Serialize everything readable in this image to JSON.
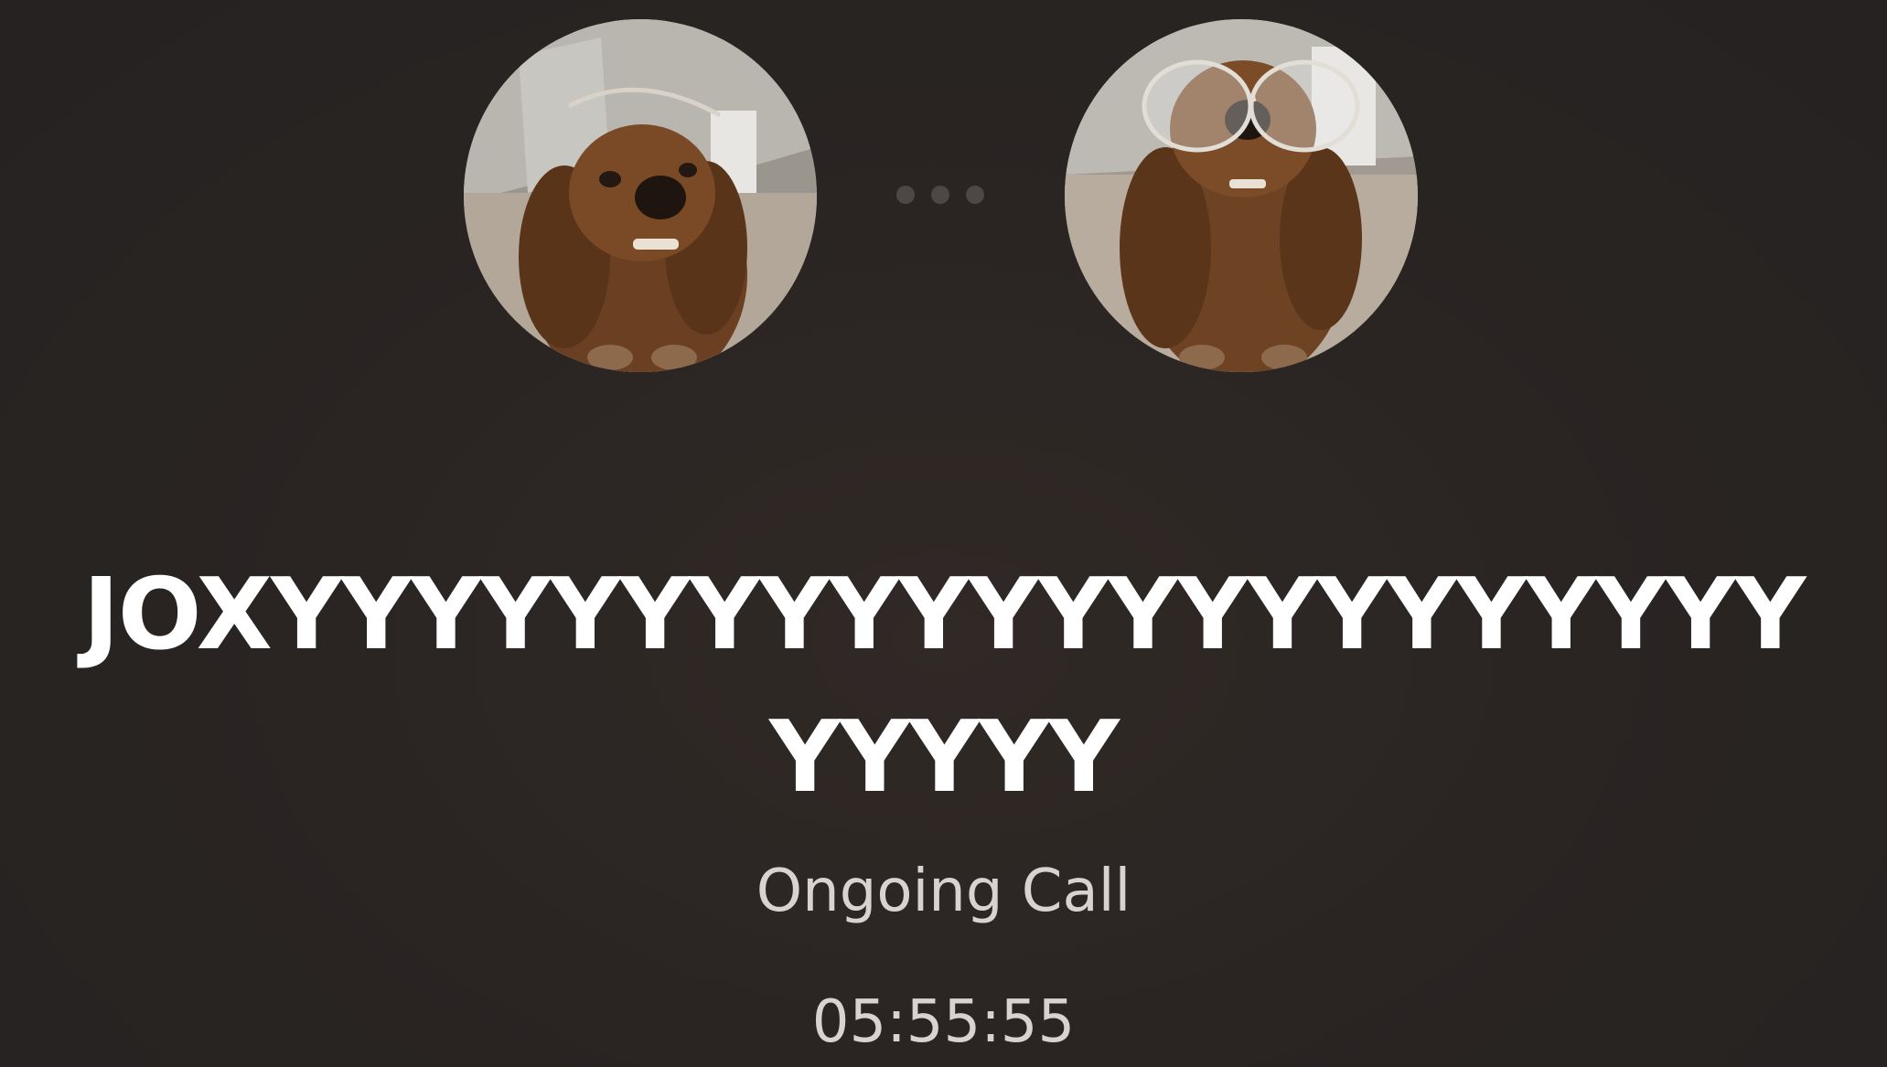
{
  "call": {
    "participants": [
      {
        "avatar": "dog-photo-avatar"
      },
      {
        "avatar": "dog-with-glasses-photo-avatar"
      }
    ],
    "connecting_indicator": "three-dots",
    "caller_name": "JOXYYYYYYYYYYYYYYYYYYYYYYYYYYY",
    "status": "Ongoing Call",
    "timer": "05:55:55"
  },
  "colors": {
    "background": "#2a2523",
    "name_text": "#ffffff",
    "status_text": "#d6d3d2",
    "dots": "#4d4745"
  }
}
